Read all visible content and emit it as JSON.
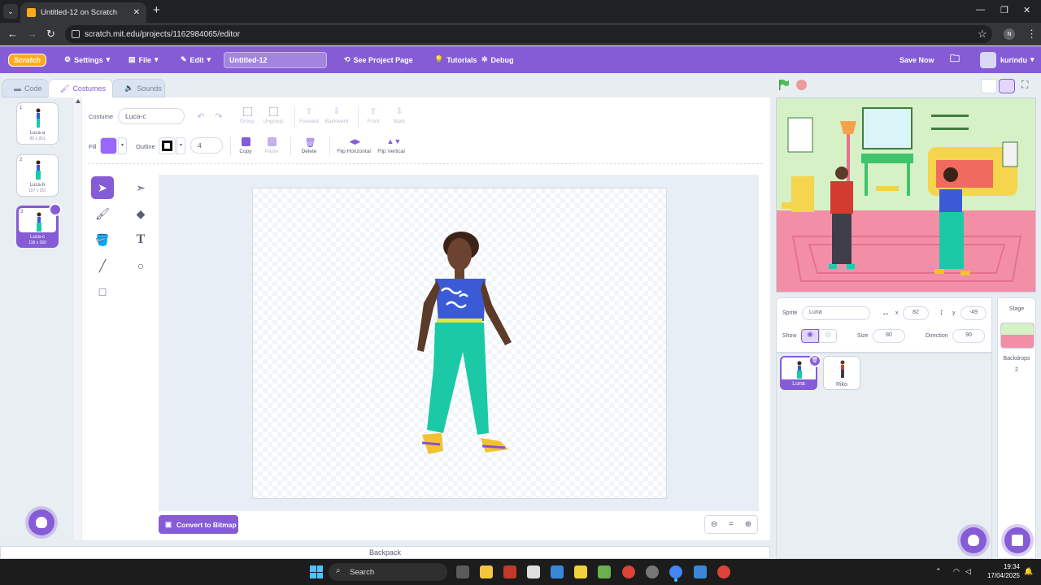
{
  "browser": {
    "tab_title": "Untitled-12 on Scratch",
    "url": "scratch.mit.edu/projects/1162984065/editor",
    "profile_initial": "N"
  },
  "menu": {
    "logo": "Scratch",
    "settings": "Settings",
    "file": "File",
    "edit": "Edit",
    "project_title": "Untitled-12",
    "see_project_page": "See Project Page",
    "tutorials": "Tutorials",
    "debug": "Debug",
    "save_now": "Save Now",
    "username": "kurindu"
  },
  "editor_tabs": {
    "code": "Code",
    "costumes": "Costumes",
    "sounds": "Sounds"
  },
  "costumes": [
    {
      "num": "1",
      "name": "Luca-a",
      "dims": "80 x 261"
    },
    {
      "num": "2",
      "name": "Luca-b",
      "dims": "107 x 261"
    },
    {
      "num": "3",
      "name": "Luca-c",
      "dims": "118 x 260"
    }
  ],
  "paint": {
    "costume_label": "Costume",
    "costume_name": "Luca-c",
    "fill_label": "Fill",
    "outline_label": "Outline",
    "outline_width": "4",
    "group": "Group",
    "ungroup": "Ungroup",
    "forward": "Forward",
    "backward": "Backward",
    "front": "Front",
    "back": "Back",
    "copy": "Copy",
    "paste": "Paste",
    "delete": "Delete",
    "flip_h": "Flip Horizontal",
    "flip_v": "Flip Vertical",
    "convert": "Convert to Bitmap",
    "fill_color": "#9966ff",
    "outline_color": "#000000"
  },
  "backpack": "Backpack",
  "sprite_info": {
    "sprite_label": "Sprite",
    "sprite_name": "Luna",
    "x_label": "x",
    "x_value": "82",
    "y_label": "y",
    "y_value": "-49",
    "show_label": "Show",
    "size_label": "Size",
    "size_value": "80",
    "direction_label": "Direction",
    "direction_value": "90"
  },
  "sprites": [
    {
      "name": "Luna"
    },
    {
      "name": "Riko"
    }
  ],
  "stage_panel": {
    "title": "Stage",
    "backdrops_label": "Backdrops",
    "backdrops_count": "2"
  },
  "taskbar": {
    "search": "Search",
    "time": "19:34",
    "date": "17/04/2025"
  },
  "colors": {
    "accent": "#855cd6",
    "accent_light": "#9966ff"
  }
}
